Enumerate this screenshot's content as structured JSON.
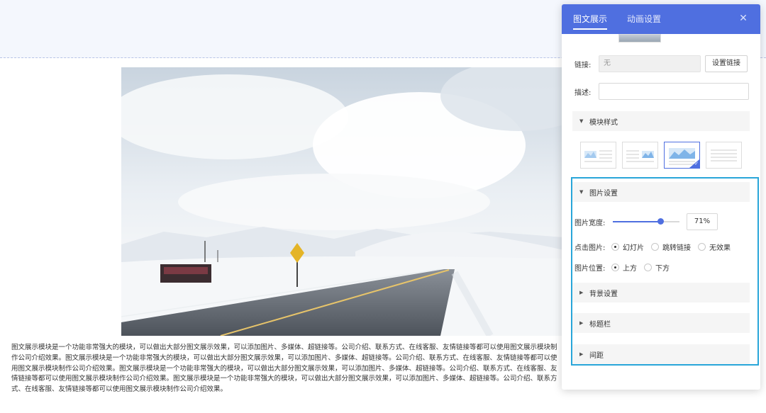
{
  "canvas": {
    "description_text": "图文展示模块是一个功能非常强大的模块，可以做出大部分图文展示效果，可以添加图片、多媒体、超链接等。公司介绍、联系方式、在线客服、友情链接等都可以使用图文展示模块制作公司介绍效果。图文展示模块是一个功能非常强大的模块，可以做出大部分图文展示效果，可以添加图片、多媒体、超链接等。公司介绍、联系方式、在线客服、友情链接等都可以使用图文展示模块制作公司介绍效果。图文展示模块是一个功能非常强大的模块，可以做出大部分图文展示效果，可以添加图片、多媒体、超链接等。公司介绍、联系方式、在线客服、友情链接等都可以使用图文展示模块制作公司介绍效果。图文展示模块是一个功能非常强大的模块，可以做出大部分图文展示效果，可以添加图片、多媒体、超链接等。公司介绍、联系方式、在线客服、友情链接等都可以使用图文展示模块制作公司介绍效果。"
  },
  "panel": {
    "tabs": [
      {
        "label": "图文展示",
        "active": true
      },
      {
        "label": "动画设置",
        "active": false
      }
    ],
    "close_icon": "close-icon",
    "link": {
      "label": "链接:",
      "value": "无",
      "button": "设置链接"
    },
    "description": {
      "label": "描述:",
      "value": ""
    },
    "module_style": {
      "title": "模块样式",
      "options": 4,
      "selected_index": 2
    },
    "image_settings": {
      "title": "图片设置",
      "width": {
        "label": "图片宽度:",
        "percent": 71,
        "display": "71%"
      },
      "click": {
        "label": "点击图片:",
        "options": [
          "幻灯片",
          "跳转链接",
          "无效果"
        ],
        "selected": 0
      },
      "position": {
        "label": "图片位置:",
        "options": [
          "上方",
          "下方"
        ],
        "selected": 0
      }
    },
    "sections": {
      "background": "背景设置",
      "titlebar": "标题栏",
      "spacing": "间距"
    }
  },
  "colors": {
    "accent": "#4f6fe0",
    "highlight": "#29a6d9"
  }
}
